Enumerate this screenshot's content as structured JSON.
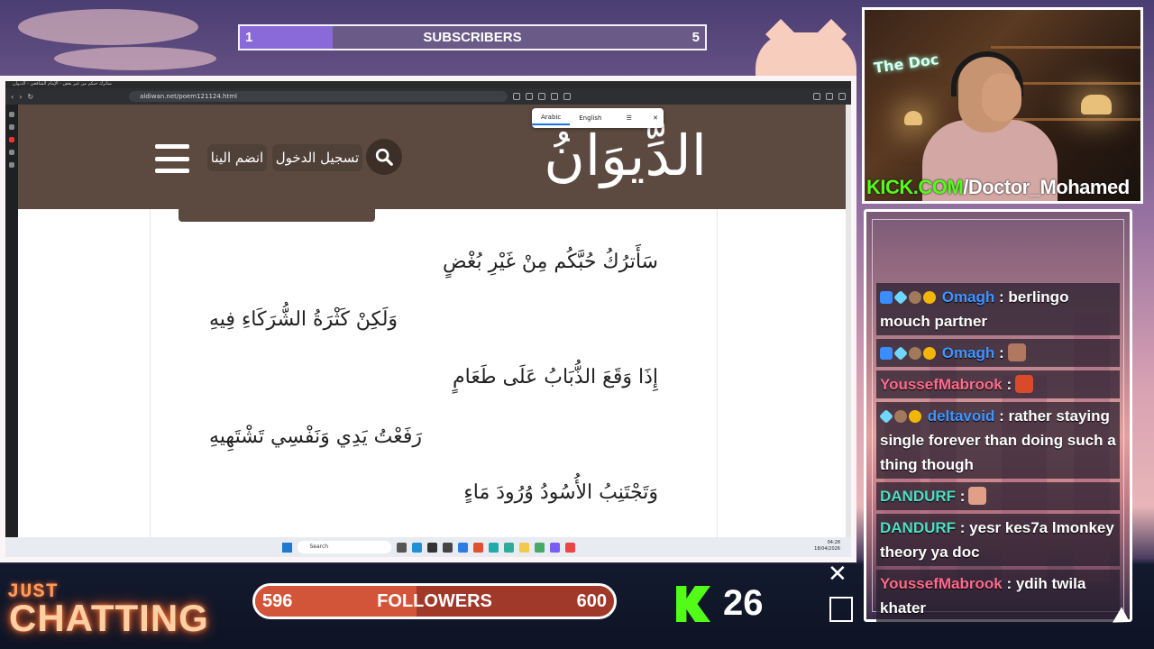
{
  "subscriber_goal": {
    "start": "1",
    "label": "SUBSCRIBERS",
    "end": "5",
    "progress": 0.2
  },
  "browser": {
    "title_strip": "سأترك حبكم من غير بغض - الإمام الشافعي - الديوان",
    "url": "aldiwan.net/poem121124.html",
    "translate": {
      "lang1": "Arabic",
      "lang2": "English"
    }
  },
  "site": {
    "logo": "الدِّيوَانُ",
    "login": "تسجيل الدخول",
    "join": "انضم الينا"
  },
  "verses": [
    "سَأَترُكُ حُبَّكُم مِنْ غَيْرِ بُغْضٍ",
    "وَلَكِنْ كَثْرَةُ الشُّرَكَاءِ فِيهِ",
    "إِذَا وَقَعَ الذُّبَابُ عَلَى طَعَامٍ",
    "رَفَعْتُ يَدِي وَنَفْسِي تَشْتَهِيهِ",
    "وَتَجْتَنِبُ الأُسُودُ وُرُودَ مَاءٍ"
  ],
  "taskbar": {
    "search": "Search",
    "time": "04:28",
    "date": "18/04/2026"
  },
  "webcam": {
    "channel_prefix": "KICK.COM",
    "channel_path": "/Doctor_Mohamed",
    "neon": "The Doc"
  },
  "chat": [
    {
      "user": "Omagh",
      "text": ": berlingo mouch partner",
      "color": "#3e95ff",
      "badges": [
        "tool",
        "gem",
        "ava",
        "coin"
      ]
    },
    {
      "user": "Omagh",
      "text": ":",
      "color": "#3e95ff",
      "badges": [
        "tool",
        "gem",
        "ava",
        "coin"
      ],
      "emote": "#b07860"
    },
    {
      "user": "YoussefMabrook",
      "text": ":",
      "color": "#ff6a8a",
      "badges": [],
      "emote": "#d84a2a"
    },
    {
      "user": "deltavoid",
      "text": ": rather staying single forever than doing such a thing though",
      "color": "#3e95ff",
      "badges": [
        "gem",
        "ava",
        "coin"
      ]
    },
    {
      "user": "DANDURF",
      "text": ":",
      "color": "#49e0c2",
      "badges": [],
      "emote": "#e0a088"
    },
    {
      "user": "DANDURF",
      "text": ": yesr kes7a lmonkey theory ya doc",
      "color": "#49e0c2",
      "badges": []
    },
    {
      "user": "YoussefMabrook",
      "text": ": ydih twila khater",
      "color": "#ff6a8a",
      "badges": []
    }
  ],
  "category": {
    "line1": "JUST",
    "line2": "CHATTING"
  },
  "follower_goal": {
    "start": "596",
    "label": "FOLLOWERS",
    "end": "600",
    "progress": 0.45
  },
  "viewers": "26",
  "colors": {
    "kick_green": "#53fc18",
    "header_brown": "#5c4a40"
  }
}
